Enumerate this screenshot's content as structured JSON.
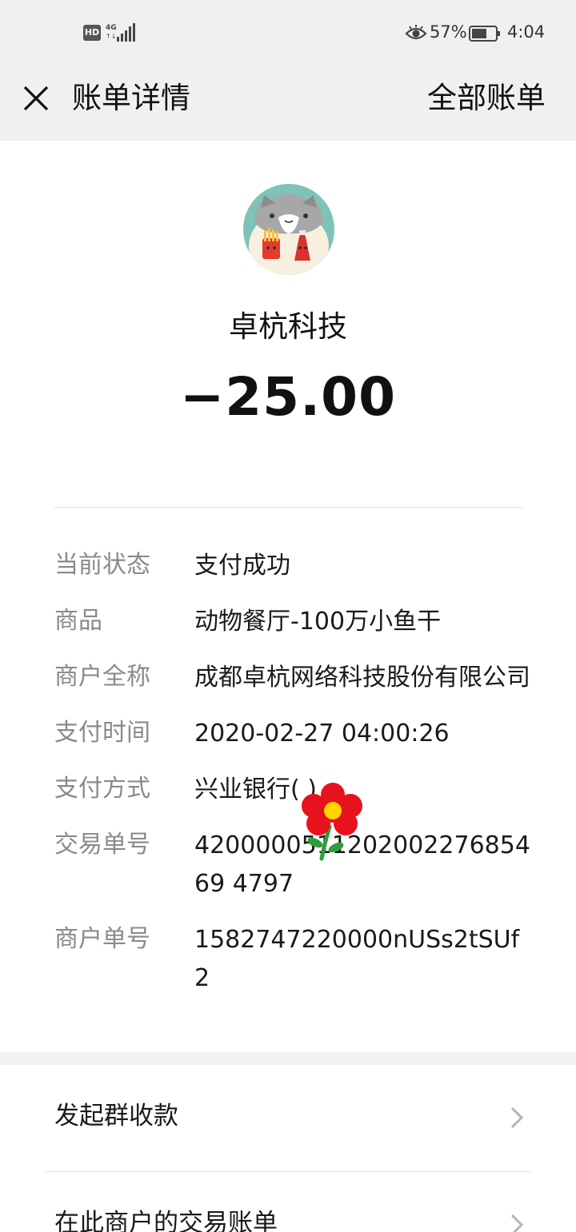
{
  "status_bar": {
    "hd_label": "HD",
    "network_label": "4G",
    "battery_percent": "57%",
    "time": "4:04"
  },
  "header": {
    "close_icon": "close-icon",
    "title": "账单详情",
    "all_bills": "全部账单"
  },
  "merchant": {
    "avatar_icon": "cartoon-cat-avatar",
    "name": "卓杭科技",
    "amount": "−25.00"
  },
  "details": [
    {
      "label": "当前状态",
      "value": "支付成功"
    },
    {
      "label": "商品",
      "value": "动物餐厅-100万小鱼干"
    },
    {
      "label": "商户全称",
      "value": "成都卓杭网络科技股份有限公司"
    },
    {
      "label": "支付时间",
      "value": "2020-02-27 04:00:26"
    },
    {
      "label": "支付方式",
      "value": "兴业银行(    )"
    },
    {
      "label": "交易单号",
      "value": "420000051120200227685469 4797"
    },
    {
      "label": "商户单号",
      "value": "1582747220000nUSs2tSUf2"
    }
  ],
  "menu": [
    {
      "label": "发起群收款"
    },
    {
      "label": "在此商户的交易账单"
    }
  ],
  "colors": {
    "header_bg": "#f0f0f0",
    "label_gray": "#8a8a8a",
    "flower_red": "#e8121c",
    "flower_center": "#ffd400",
    "avatar_bg": "#7fc3b8"
  }
}
